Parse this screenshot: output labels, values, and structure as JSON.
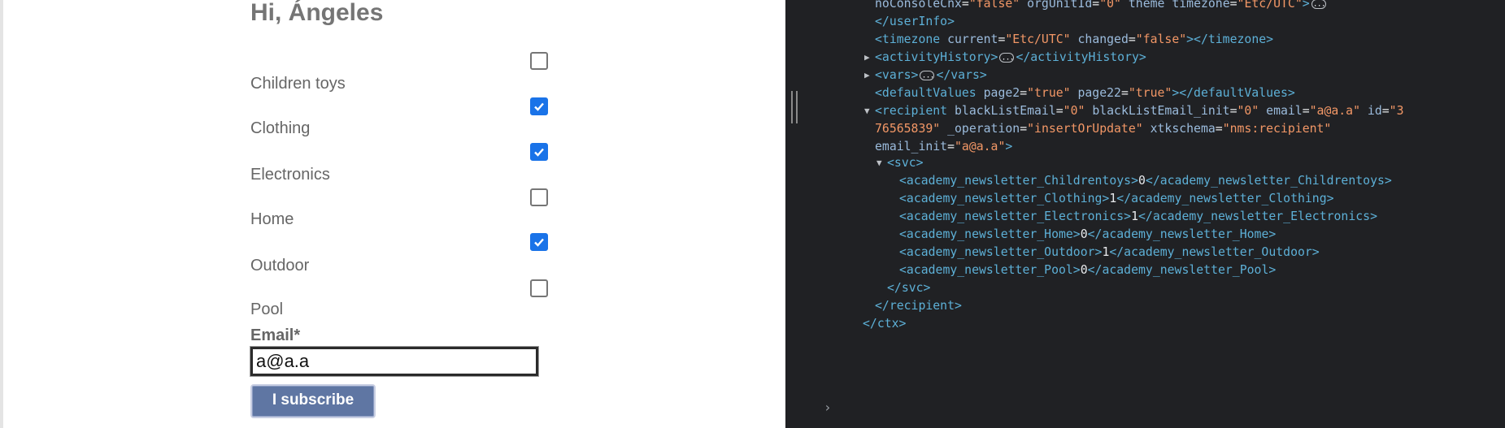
{
  "form": {
    "greeting": "Hi, Ángeles",
    "categories": [
      {
        "label": "Children toys",
        "checked": false
      },
      {
        "label": "Clothing",
        "checked": true
      },
      {
        "label": "Electronics",
        "checked": true
      },
      {
        "label": "Home",
        "checked": false
      },
      {
        "label": "Outdoor",
        "checked": true
      },
      {
        "label": "Pool",
        "checked": false
      }
    ],
    "email_label": "Email*",
    "email_value": "a@a.a",
    "subscribe_label": "I subscribe",
    "checkbox_color": "#1a73e8",
    "button_color": "#5f76a3"
  },
  "devtools": {
    "lines": [
      {
        "parts": [
          {
            "t": "attr",
            "v": "noConsoleCnx"
          },
          {
            "t": "txt",
            "v": "="
          },
          {
            "t": "val",
            "v": "\"false\""
          },
          {
            "t": "txt",
            "v": " "
          },
          {
            "t": "attr",
            "v": "orgUnitId"
          },
          {
            "t": "txt",
            "v": "="
          },
          {
            "t": "val",
            "v": "\"0\""
          },
          {
            "t": "txt",
            "v": " "
          },
          {
            "t": "attr",
            "v": "theme"
          },
          {
            "t": "txt",
            "v": " "
          },
          {
            "t": "attr",
            "v": "timezone"
          },
          {
            "t": "txt",
            "v": "="
          },
          {
            "t": "val",
            "v": "\"Etc/UTC\""
          },
          {
            "t": "tag",
            "v": ">"
          }
        ],
        "more": true
      },
      {
        "parts": [
          {
            "t": "tag",
            "v": "</userInfo>"
          }
        ]
      },
      {
        "parts": [
          {
            "t": "tag",
            "v": "<timezone"
          },
          {
            "t": "txt",
            "v": " "
          },
          {
            "t": "attr",
            "v": "current"
          },
          {
            "t": "txt",
            "v": "="
          },
          {
            "t": "val",
            "v": "\"Etc/UTC\""
          },
          {
            "t": "txt",
            "v": " "
          },
          {
            "t": "attr",
            "v": "changed"
          },
          {
            "t": "txt",
            "v": "="
          },
          {
            "t": "val",
            "v": "\"false\""
          },
          {
            "t": "tag",
            "v": "></timezone>"
          }
        ]
      },
      {
        "parts": [
          {
            "t": "tag",
            "v": "<activityHistory>"
          },
          {
            "t": "more"
          },
          {
            "t": "tag",
            "v": "</activityHistory>"
          }
        ],
        "triangle": "collapsed"
      },
      {
        "parts": [
          {
            "t": "tag",
            "v": "<vars>"
          },
          {
            "t": "more"
          },
          {
            "t": "tag",
            "v": "</vars>"
          }
        ],
        "triangle": "collapsed"
      },
      {
        "parts": [
          {
            "t": "tag",
            "v": "<defaultValues"
          },
          {
            "t": "txt",
            "v": " "
          },
          {
            "t": "attr",
            "v": "page2"
          },
          {
            "t": "txt",
            "v": "="
          },
          {
            "t": "val",
            "v": "\"true\""
          },
          {
            "t": "txt",
            "v": " "
          },
          {
            "t": "attr",
            "v": "page22"
          },
          {
            "t": "txt",
            "v": "="
          },
          {
            "t": "val",
            "v": "\"true\""
          },
          {
            "t": "tag",
            "v": "></defaultValues>"
          }
        ]
      },
      {
        "parts": [
          {
            "t": "tag",
            "v": "<recipient"
          },
          {
            "t": "txt",
            "v": " "
          },
          {
            "t": "attr",
            "v": "blackListEmail"
          },
          {
            "t": "txt",
            "v": "="
          },
          {
            "t": "val",
            "v": "\"0\""
          },
          {
            "t": "txt",
            "v": " "
          },
          {
            "t": "attr",
            "v": "blackListEmail_init"
          },
          {
            "t": "txt",
            "v": "="
          },
          {
            "t": "val",
            "v": "\"0\""
          },
          {
            "t": "txt",
            "v": " "
          },
          {
            "t": "attr",
            "v": "email"
          },
          {
            "t": "txt",
            "v": "="
          },
          {
            "t": "val",
            "v": "\"a@a.a\""
          },
          {
            "t": "txt",
            "v": " "
          },
          {
            "t": "attr",
            "v": "id"
          },
          {
            "t": "txt",
            "v": "="
          },
          {
            "t": "val",
            "v": "\"3"
          }
        ],
        "triangle": "expanded"
      },
      {
        "parts": [
          {
            "t": "val",
            "v": "76565839\""
          },
          {
            "t": "txt",
            "v": " "
          },
          {
            "t": "attr",
            "v": "_operation"
          },
          {
            "t": "txt",
            "v": "="
          },
          {
            "t": "val",
            "v": "\"insertOrUpdate\""
          },
          {
            "t": "txt",
            "v": " "
          },
          {
            "t": "attr",
            "v": "xtkschema"
          },
          {
            "t": "txt",
            "v": "="
          },
          {
            "t": "val",
            "v": "\"nms:recipient\""
          }
        ]
      },
      {
        "parts": [
          {
            "t": "attr",
            "v": "email_init"
          },
          {
            "t": "txt",
            "v": "="
          },
          {
            "t": "val",
            "v": "\"a@a.a\""
          },
          {
            "t": "tag",
            "v": ">"
          }
        ]
      },
      {
        "parts": [
          {
            "t": "tag",
            "v": "<svc>"
          }
        ],
        "triangle": "expanded"
      },
      {
        "parts": [
          {
            "t": "tag",
            "v": "<academy_newsletter_Childrentoys>"
          },
          {
            "t": "txt",
            "v": "0"
          },
          {
            "t": "tag",
            "v": "</academy_newsletter_Childrentoys>"
          }
        ]
      },
      {
        "parts": [
          {
            "t": "tag",
            "v": "<academy_newsletter_Clothing>"
          },
          {
            "t": "txt",
            "v": "1"
          },
          {
            "t": "tag",
            "v": "</academy_newsletter_Clothing>"
          }
        ]
      },
      {
        "parts": [
          {
            "t": "tag",
            "v": "<academy_newsletter_Electronics>"
          },
          {
            "t": "txt",
            "v": "1"
          },
          {
            "t": "tag",
            "v": "</academy_newsletter_Electronics>"
          }
        ]
      },
      {
        "parts": [
          {
            "t": "tag",
            "v": "<academy_newsletter_Home>"
          },
          {
            "t": "txt",
            "v": "0"
          },
          {
            "t": "tag",
            "v": "</academy_newsletter_Home>"
          }
        ]
      },
      {
        "parts": [
          {
            "t": "tag",
            "v": "<academy_newsletter_Outdoor>"
          },
          {
            "t": "txt",
            "v": "1"
          },
          {
            "t": "tag",
            "v": "</academy_newsletter_Outdoor>"
          }
        ]
      },
      {
        "parts": [
          {
            "t": "tag",
            "v": "<academy_newsletter_Pool>"
          },
          {
            "t": "txt",
            "v": "0"
          },
          {
            "t": "tag",
            "v": "</academy_newsletter_Pool>"
          }
        ]
      },
      {
        "parts": [
          {
            "t": "tag",
            "v": "</svc>"
          }
        ]
      },
      {
        "parts": [
          {
            "t": "tag",
            "v": "</recipient>"
          }
        ]
      },
      {
        "parts": [
          {
            "t": "tag",
            "v": "</ctx>"
          }
        ]
      }
    ],
    "console_prompt": "›",
    "colors": {
      "background": "#202124",
      "tag": "#5db0d7",
      "attr": "#9bbbdc",
      "value": "#f29766",
      "text": "#e8eaed"
    }
  }
}
